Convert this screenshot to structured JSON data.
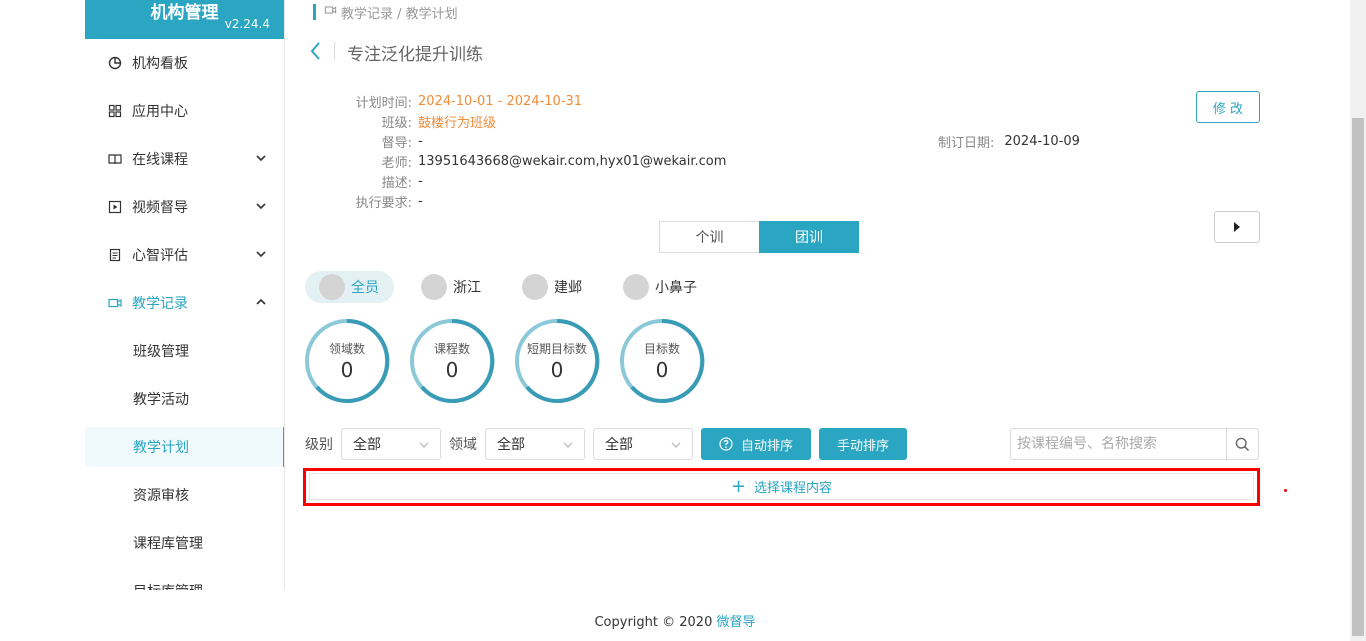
{
  "sidebar": {
    "brand_title": "机构管理",
    "version": "v2.24.4",
    "items": [
      {
        "label": "机构看板"
      },
      {
        "label": "应用中心"
      },
      {
        "label": "在线课程"
      },
      {
        "label": "视频督导"
      },
      {
        "label": "心智评估"
      },
      {
        "label": "教学记录"
      },
      {
        "label": "班级管理"
      },
      {
        "label": "教学活动"
      },
      {
        "label": "教学计划"
      },
      {
        "label": "资源审核"
      },
      {
        "label": "课程库管理"
      },
      {
        "label": "目标库管理"
      }
    ]
  },
  "breadcrumb": "教学记录 / 教学计划",
  "page_title": "专注泛化提升训练",
  "info": {
    "plan_time_label": "计划时间:",
    "plan_time_value": "2024-10-01 - 2024-10-31",
    "class_label": "班级:",
    "class_value": "鼓楼行为班级",
    "supervisor_label": "督导:",
    "supervisor_value": "-",
    "teacher_label": "老师:",
    "teacher_value": "13951643668@wekair.com,hyx01@wekair.com",
    "desc_label": "描述:",
    "desc_value": "-",
    "req_label": "执行要求:",
    "req_value": "-",
    "made_date_label": "制订日期:",
    "made_date_value": "2024-10-09"
  },
  "edit_label": "修 改",
  "segment": {
    "individual": "个训",
    "group": "团训",
    "selected": "团训"
  },
  "members": [
    {
      "name": "全员"
    },
    {
      "name": "浙江"
    },
    {
      "name": "建邺"
    },
    {
      "name": "小鼻子"
    }
  ],
  "stats": [
    {
      "label": "领域数",
      "value": "0"
    },
    {
      "label": "课程数",
      "value": "0"
    },
    {
      "label": "短期目标数",
      "value": "0"
    },
    {
      "label": "目标数",
      "value": "0"
    }
  ],
  "filters": {
    "level_label": "级别",
    "level_value": "全部",
    "domain_label": "领域",
    "domain_value": "全部",
    "third_value": "全部",
    "auto_sort": "自动排序",
    "manual_sort": "手动排序",
    "search_placeholder": "按课程编号、名称搜索"
  },
  "add_content_label": "选择课程内容",
  "footer": {
    "text": "Copyright © 2020 ",
    "link": "微督导"
  },
  "colors": {
    "accent": "#2aa5c2",
    "orange": "#f08c3a",
    "highlight": "#ff0000"
  }
}
